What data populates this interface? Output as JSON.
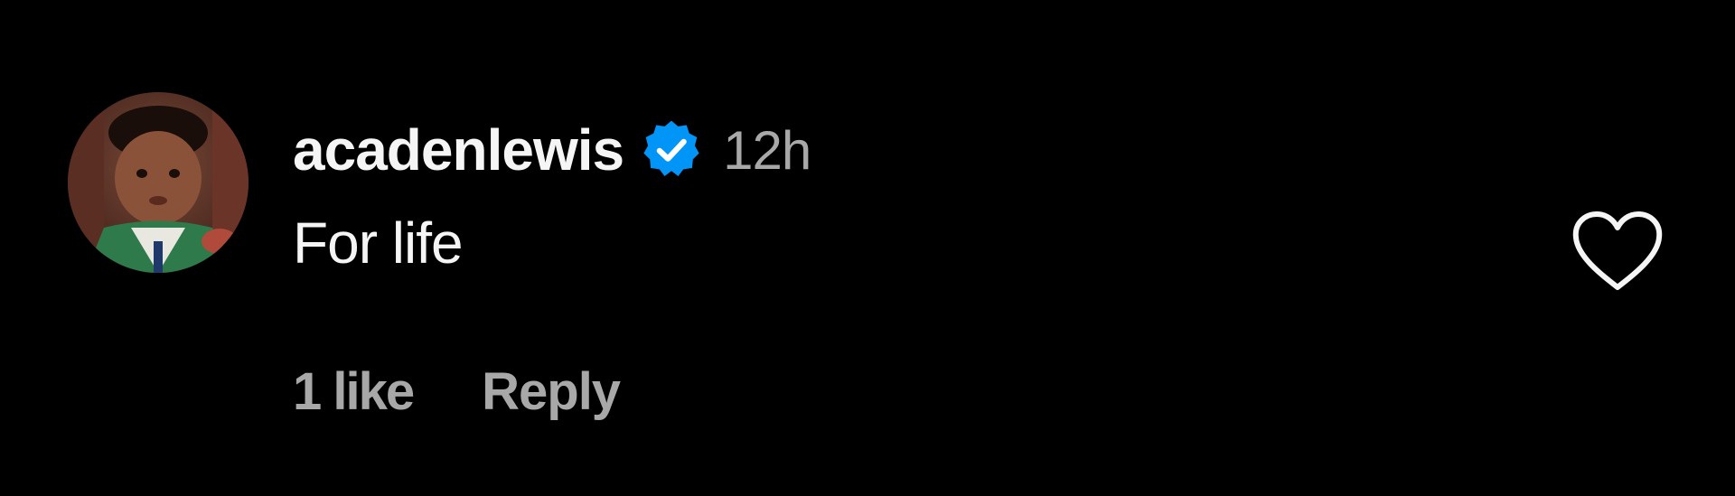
{
  "comment": {
    "username": "acadenlewis",
    "timestamp": "12h",
    "text": "For life",
    "likes": "1 like",
    "reply_label": "Reply",
    "verified_icon": "verified-badge-icon",
    "like_icon": "heart-outline-icon"
  },
  "colors": {
    "background": "#000000",
    "primary_text": "#f5f5f5",
    "secondary_text": "#a8a8a8",
    "verified_blue": "#0095f6"
  }
}
